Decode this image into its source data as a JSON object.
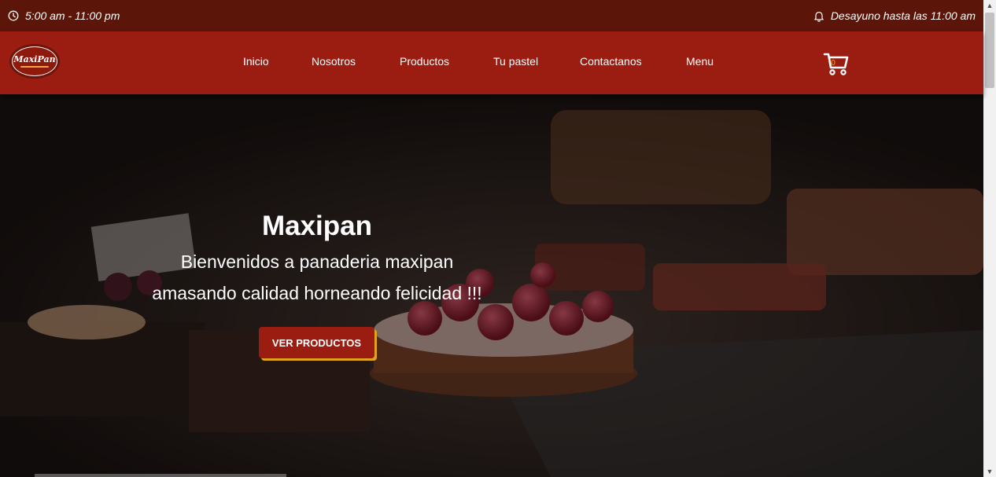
{
  "topbar": {
    "hours": "5:00 am - 11:00 pm",
    "breakfast": "Desayuno hasta las 11:00 am",
    "hours_icon": "clock-icon",
    "breakfast_icon": "bell-icon"
  },
  "logo": {
    "text": "MaxiPan"
  },
  "nav": {
    "items": [
      {
        "label": "Inicio"
      },
      {
        "label": "Nosotros"
      },
      {
        "label": "Productos"
      },
      {
        "label": "Tu pastel"
      },
      {
        "label": "Contactanos"
      },
      {
        "label": "Menu"
      }
    ],
    "cart_icon": "cart-icon",
    "cart_count": "0"
  },
  "hero": {
    "title": "Maxipan",
    "line1": "Bienvenidos a panaderia maxipan",
    "line2": "amasando calidad horneando felicidad !!!",
    "button": "VER PRODUCTOS"
  },
  "colors": {
    "topbar": "#5c1509",
    "navbar": "#9b1c10",
    "button": "#9b1c10",
    "button_shadow": "#e0a21f",
    "cart": "#ffffff"
  }
}
